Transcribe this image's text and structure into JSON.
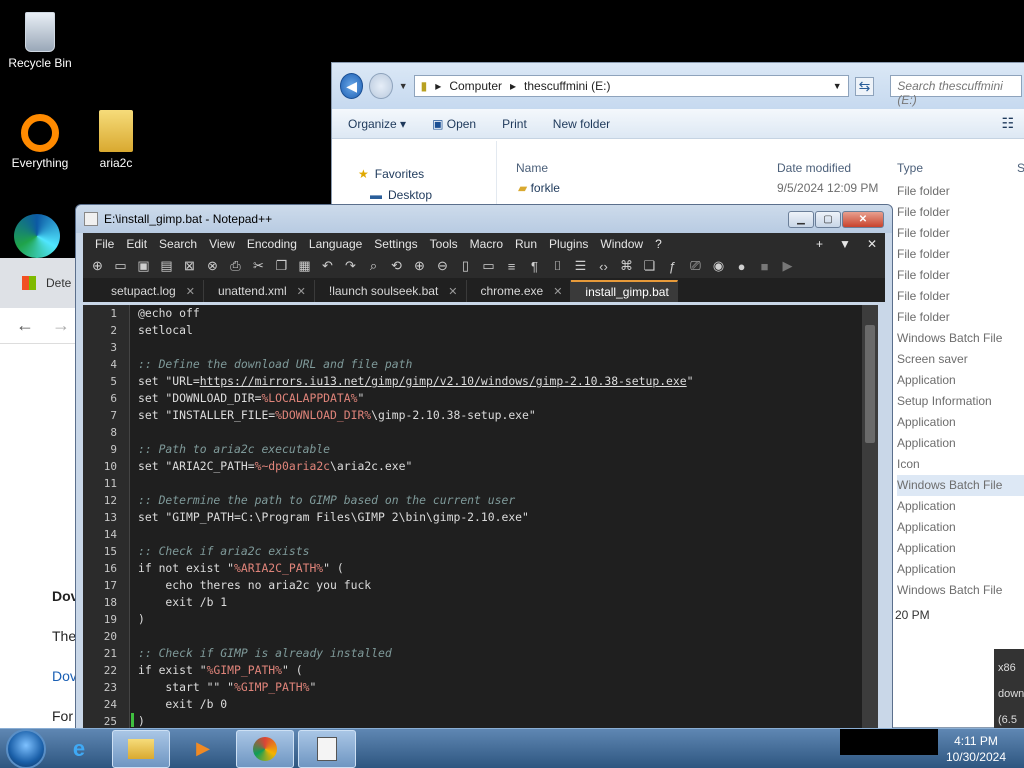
{
  "desktop": {
    "icons": [
      {
        "label": "Recycle Bin",
        "icon": "recycle-bin-icon"
      },
      {
        "label": "Everything",
        "icon": "everything-icon"
      },
      {
        "label": "aria2c",
        "icon": "folder-icon"
      }
    ]
  },
  "explorer": {
    "path": [
      "Computer",
      "thescuffmini (E:)"
    ],
    "search_placeholder": "Search thescuffmini (E:)",
    "toolbar": [
      "Organize ▾",
      "Open",
      "Print",
      "New folder"
    ],
    "nav": [
      "Favorites",
      "Desktop"
    ],
    "columns": {
      "name": "Name",
      "date": "Date modified",
      "type": "Type",
      "size": "Si"
    },
    "first_row": {
      "name": "forkle",
      "date": "9/5/2024 12:09 PM"
    },
    "types": [
      "File folder",
      "File folder",
      "File folder",
      "File folder",
      "File folder",
      "File folder",
      "File folder",
      "Windows Batch File",
      "Screen saver",
      "Application",
      "Setup Information",
      "Application",
      "Application",
      "Icon",
      "Windows Batch File",
      "Application",
      "Application",
      "Application",
      "Application",
      "Windows Batch File"
    ],
    "selected_index": 14,
    "bottom_time": "20 PM"
  },
  "chrome": {
    "tab_label": "Dete"
  },
  "notepad": {
    "title": "E:\\install_gimp.bat - Notepad++",
    "menu": [
      "File",
      "Edit",
      "Search",
      "View",
      "Encoding",
      "Language",
      "Settings",
      "Tools",
      "Macro",
      "Run",
      "Plugins",
      "Window",
      "?"
    ],
    "menu_right": [
      "+",
      "▼",
      "✕"
    ],
    "tabs": [
      {
        "label": "setupact.log",
        "active": false
      },
      {
        "label": "unattend.xml",
        "active": false
      },
      {
        "label": "!launch soulseek.bat",
        "active": false
      },
      {
        "label": "chrome.exe",
        "active": false
      },
      {
        "label": "install_gimp.bat",
        "active": true
      }
    ],
    "lines": [
      "@echo off",
      "setlocal",
      "",
      ":: Define the download URL and file path",
      "set \"URL=https://mirrors.iu13.net/gimp/gimp/v2.10/windows/gimp-2.10.38-setup.exe\"",
      "set \"DOWNLOAD_DIR=%LOCALAPPDATA%\"",
      "set \"INSTALLER_FILE=%DOWNLOAD_DIR%\\gimp-2.10.38-setup.exe\"",
      "",
      ":: Path to aria2c executable",
      "set \"ARIA2C_PATH=%~dp0aria2c\\aria2c.exe\"",
      "",
      ":: Determine the path to GIMP based on the current user",
      "set \"GIMP_PATH=C:\\Program Files\\GIMP 2\\bin\\gimp-2.10.exe\"",
      "",
      ":: Check if aria2c exists",
      "if not exist \"%ARIA2C_PATH%\" (",
      "    echo theres no aria2c you fuck",
      "    exit /b 1",
      ")",
      "",
      ":: Check if GIMP is already installed",
      "if exist \"%GIMP_PATH%\" (",
      "    start \"\" \"%GIMP_PATH%\"",
      "    exit /b 0",
      ")"
    ]
  },
  "taskbar": {
    "time": "4:11 PM",
    "date": "10/30/2024"
  }
}
